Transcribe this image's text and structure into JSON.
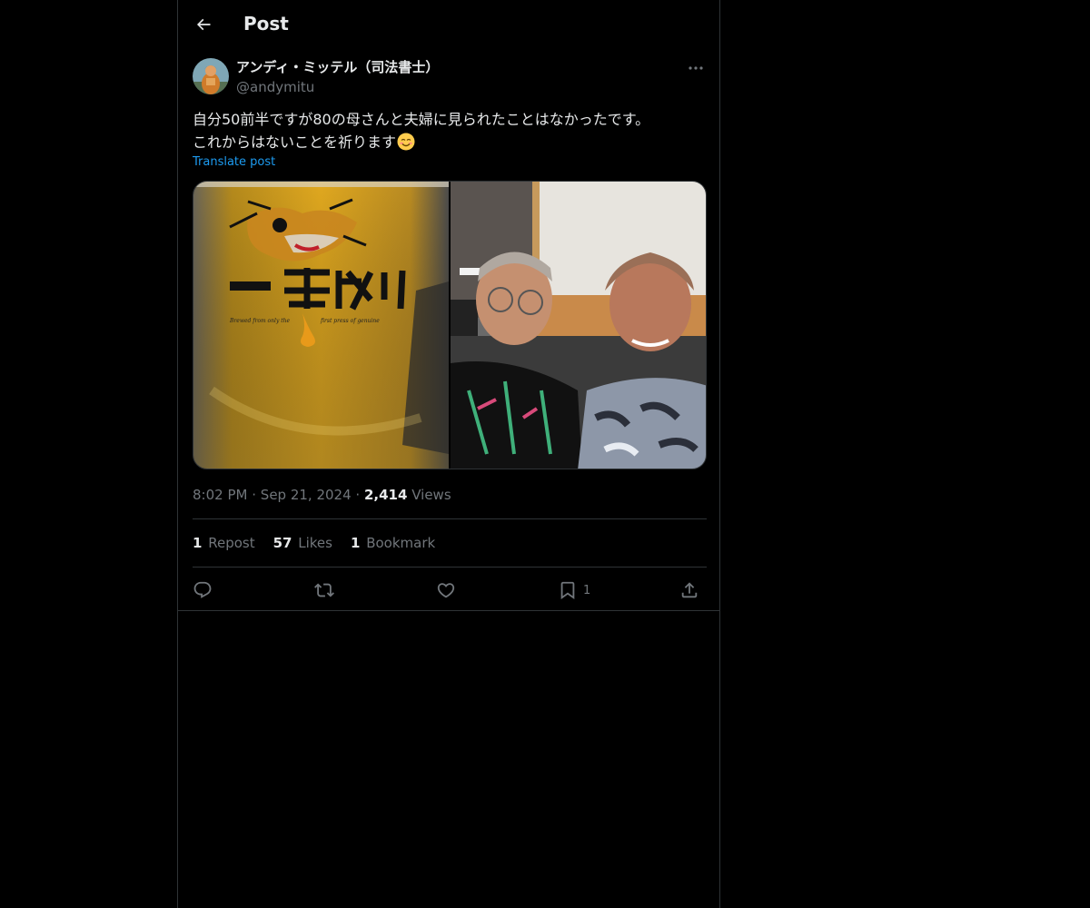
{
  "header": {
    "title": "Post",
    "back_icon": "arrow-left-icon"
  },
  "post": {
    "author_name": "アンディ・ミッテル（司法書士）",
    "author_handle": "@andymitu",
    "text_line1": "自分50前半ですが80の母さんと夫婦に見られたことはなかったです。",
    "text_line2": "これからはないことを祈ります",
    "emoji": "smiling-face-icon",
    "translate_label": "Translate post",
    "time": "8:02 PM",
    "date": "Sep 21, 2024",
    "separator": "·",
    "views_count": "2,414",
    "views_label": "Views"
  },
  "stats": {
    "reposts_count": "1",
    "reposts_label": "Repost",
    "likes_count": "57",
    "likes_label": "Likes",
    "bookmarks_count": "1",
    "bookmarks_label": "Bookmark"
  },
  "actions": {
    "reply_icon": "reply-icon",
    "repost_icon": "repost-icon",
    "like_icon": "heart-icon",
    "bookmark_icon": "bookmark-icon",
    "bookmark_count": "1",
    "share_icon": "share-icon"
  },
  "media": {
    "image1": "beer-glass-photo",
    "image2": "selfie-photo"
  },
  "colors": {
    "background": "#000000",
    "text_primary": "#e7e9ea",
    "text_secondary": "#71767b",
    "link": "#1d9bf0",
    "border": "#2f3336"
  }
}
